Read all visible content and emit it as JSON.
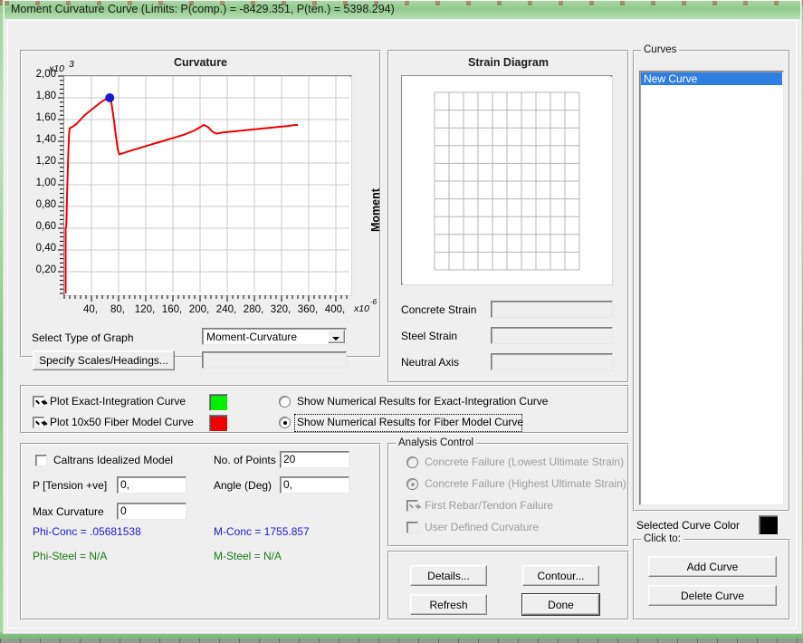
{
  "window": {
    "title": "Moment Curvature Curve (Limits:  P(comp.) = -8429.351, P(ten.) = 5398.294)"
  },
  "graph_panel": {
    "title": "Curvature",
    "y_axis_label": "Moment",
    "y_exponent_prefix": "x10",
    "y_exponent": "3",
    "x_exponent_prefix": "x10",
    "x_exponent": "-6",
    "select_type_label": "Select Type of Graph",
    "graph_type_value": "Moment-Curvature",
    "specify_scales_button": "Specify Scales/Headings...",
    "scales_field_value": ""
  },
  "chart_data": {
    "type": "line",
    "title": "Curvature",
    "xlabel": "Curvature",
    "ylabel": "Moment",
    "xlim": [
      0,
      420
    ],
    "ylim": [
      0,
      2.0
    ],
    "x_ticks": [
      40,
      80,
      120,
      160,
      200,
      240,
      280,
      320,
      360,
      400
    ],
    "x_tick_labels": [
      "40,",
      "80,",
      "120,",
      "160,",
      "200,",
      "240,",
      "280,",
      "320,",
      "360,",
      "400,"
    ],
    "y_ticks": [
      0.2,
      0.4,
      0.6,
      0.8,
      1.0,
      1.2,
      1.4,
      1.6,
      1.8,
      2.0
    ],
    "y_tick_labels": [
      "0,20",
      "0,40",
      "0,60",
      "0,80",
      "1,00",
      "1,20",
      "1,40",
      "1,60",
      "1,80",
      "2,00"
    ],
    "x_scale_note": "x10 -6",
    "y_scale_note": "x10 3",
    "grid": true,
    "legend": "none",
    "series": [
      {
        "name": "Plot 10x50 Fiber Model Curve",
        "color": "#ee0000",
        "points": [
          [
            2,
            0.0
          ],
          [
            2,
            0.6
          ],
          [
            3,
            0.62
          ],
          [
            4,
            0.88
          ],
          [
            5,
            1.1
          ],
          [
            6,
            1.3
          ],
          [
            7,
            1.46
          ],
          [
            8,
            1.52
          ],
          [
            11,
            1.53
          ],
          [
            14,
            1.54
          ],
          [
            18,
            1.56
          ],
          [
            24,
            1.6
          ],
          [
            30,
            1.64
          ],
          [
            38,
            1.68
          ],
          [
            46,
            1.72
          ],
          [
            54,
            1.76
          ],
          [
            62,
            1.79
          ],
          [
            66,
            1.8
          ],
          [
            68,
            1.8
          ],
          [
            70,
            1.73
          ],
          [
            73,
            1.6
          ],
          [
            76,
            1.45
          ],
          [
            79,
            1.32
          ],
          [
            81,
            1.28
          ],
          [
            96,
            1.31
          ],
          [
            112,
            1.34
          ],
          [
            128,
            1.37
          ],
          [
            144,
            1.4
          ],
          [
            160,
            1.43
          ],
          [
            176,
            1.46
          ],
          [
            192,
            1.5
          ],
          [
            200,
            1.53
          ],
          [
            206,
            1.55
          ],
          [
            212,
            1.53
          ],
          [
            218,
            1.49
          ],
          [
            224,
            1.47
          ],
          [
            232,
            1.48
          ],
          [
            248,
            1.49
          ],
          [
            264,
            1.5
          ],
          [
            280,
            1.51
          ],
          [
            296,
            1.52
          ],
          [
            312,
            1.53
          ],
          [
            328,
            1.54
          ],
          [
            340,
            1.55
          ],
          [
            344,
            1.55
          ]
        ]
      }
    ],
    "markers": [
      {
        "name": "peak-marker",
        "x": 67,
        "y": 1.8,
        "color": "#1a1ad0",
        "shape": "circle"
      }
    ]
  },
  "strain_panel": {
    "title": "Strain Diagram",
    "fields": [
      {
        "label": "Concrete Strain",
        "value": ""
      },
      {
        "label": "Steel Strain",
        "value": ""
      },
      {
        "label": "Neutral Axis",
        "value": ""
      }
    ]
  },
  "plot_options": {
    "checkboxes": [
      {
        "label": "Plot Exact-Integration Curve",
        "checked": true,
        "color": "#00ee00"
      },
      {
        "label": "Plot 10x50 Fiber Model Curve",
        "checked": true,
        "color": "#ee0000"
      }
    ],
    "radios": [
      {
        "label": "Show Numerical Results for Exact-Integration Curve",
        "selected": false,
        "focused": false
      },
      {
        "label": "Show Numerical Results for Fiber Model Curve",
        "selected": true,
        "focused": true
      }
    ]
  },
  "inputs_panel": {
    "caltrans_checkbox_label": "Caltrans Idealized Model",
    "caltrans_checked": false,
    "fields": [
      {
        "label": "P [Tension +ve]",
        "value": "0,"
      },
      {
        "label": "Max Curvature",
        "value": "0"
      },
      {
        "label": "No. of Points",
        "value": "20"
      },
      {
        "label": "Angle (Deg)",
        "value": "0,"
      }
    ],
    "results": [
      {
        "text": "Phi-Conc = .05681538",
        "color": "#1a1ad0"
      },
      {
        "text": "M-Conc = 1755.857",
        "color": "#1a1ad0"
      },
      {
        "text": "Phi-Steel = N/A",
        "color": "#157a15"
      },
      {
        "text": "M-Steel = N/A",
        "color": "#157a15"
      }
    ]
  },
  "analysis_control": {
    "title": "Analysis Control",
    "enabled": false,
    "items": [
      {
        "type": "radio",
        "label": "Concrete Failure (Lowest Ultimate Strain)",
        "selected": false
      },
      {
        "type": "radio",
        "label": "Concrete Failure (Highest Ultimate Strain)",
        "selected": true
      },
      {
        "type": "checkbox",
        "label": "First Rebar/Tendon Failure",
        "checked": true
      },
      {
        "type": "checkbox",
        "label": "User Defined Curvature",
        "checked": false
      }
    ]
  },
  "action_buttons": {
    "details": "Details...",
    "contour": "Contour...",
    "refresh": "Refresh",
    "done": "Done"
  },
  "curves_panel": {
    "title": "Curves",
    "items": [
      "New Curve"
    ],
    "selected_index": 0,
    "selected_curve_color_label": "Selected Curve Color",
    "selected_curve_color": "#000000",
    "click_to_title": "Click to:",
    "add_curve_button": "Add Curve",
    "delete_curve_button": "Delete Curve"
  }
}
